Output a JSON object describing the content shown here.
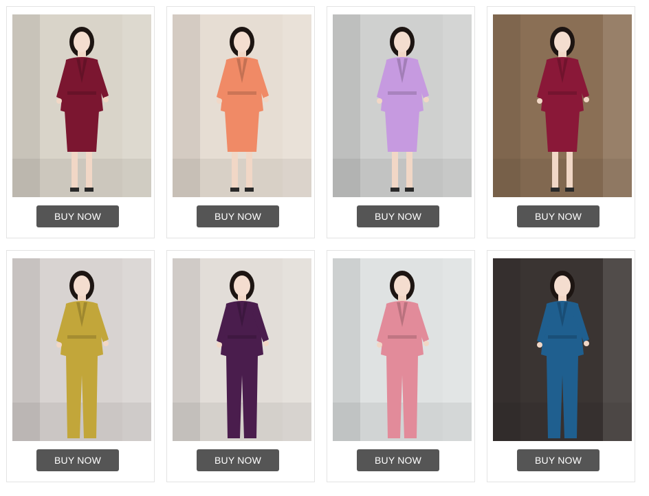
{
  "products": [
    {
      "button_label": "BUY NOW",
      "image": "woman-burgundy-skirt-suit-photo",
      "colors": {
        "bg": "#d9d4c9",
        "suit": "#7b1630",
        "skirt": "#7b1630",
        "accent": "#f3efe8"
      }
    },
    {
      "button_label": "BUY NOW",
      "image": "woman-coral-skirt-suit-photo",
      "colors": {
        "bg": "#e6ddd3",
        "suit": "#f08a66",
        "skirt": "#f08a66",
        "accent": "#f7f3ef"
      }
    },
    {
      "button_label": "BUY NOW",
      "image": "woman-lilac-skirt-suit-photo",
      "colors": {
        "bg": "#cfd0cf",
        "suit": "#c69ae0",
        "skirt": "#c69ae0",
        "accent": "#f2f2f2"
      }
    },
    {
      "button_label": "BUY NOW",
      "image": "woman-wine-skirt-suit-photo",
      "colors": {
        "bg": "#8a6f55",
        "suit": "#8a1838",
        "skirt": "#8a1838",
        "accent": "#2c2c2c"
      }
    },
    {
      "button_label": "BUY NOW",
      "image": "woman-mustard-pant-suit-photo",
      "colors": {
        "bg": "#d8d3d1",
        "suit": "#c2a63a",
        "skirt": "#c2a63a",
        "accent": "#1c1c1c"
      }
    },
    {
      "button_label": "BUY NOW",
      "image": "woman-purple-pant-suit-photo",
      "colors": {
        "bg": "#e2ddd8",
        "suit": "#4a1d4d",
        "skirt": "#4a1d4d",
        "accent": "#ffffff"
      }
    },
    {
      "button_label": "BUY NOW",
      "image": "woman-pink-check-pant-suit-photo",
      "colors": {
        "bg": "#dfe2e2",
        "suit": "#e28b9a",
        "skirt": "#e28b9a",
        "accent": "#d5b07d"
      }
    },
    {
      "button_label": "BUY NOW",
      "image": "woman-teal-pant-suit-photo",
      "colors": {
        "bg": "#3a3432",
        "suit": "#1f5f8f",
        "skirt": "#1f5f8f",
        "accent": "#f2f2f2"
      }
    }
  ]
}
